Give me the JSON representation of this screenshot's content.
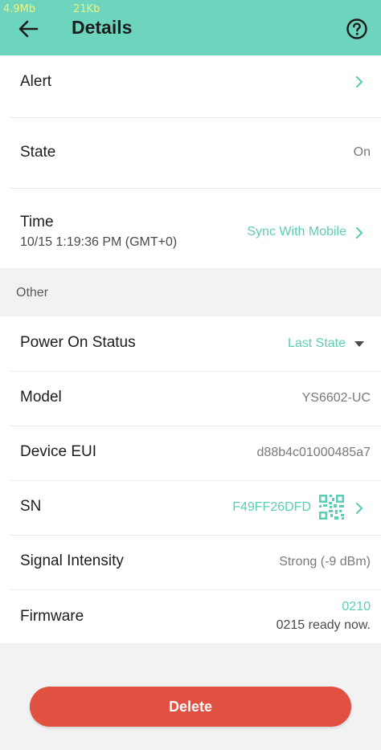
{
  "status_bar": {
    "memory": "4.9Mb",
    "network": "21Kb"
  },
  "header": {
    "title": "Details",
    "back_icon": "arrow-left-icon",
    "help_icon": "help-circle-icon"
  },
  "rows_top": [
    {
      "label": "Alert"
    },
    {
      "label": "State",
      "value": "On"
    },
    {
      "label": "Time",
      "sub": "10/15 1:19:36 PM (GMT+0)",
      "value": "Sync With Mobile"
    }
  ],
  "section": {
    "title": "Other"
  },
  "rows_other": [
    {
      "label": "Power On Status",
      "value": "Last State"
    },
    {
      "label": "Model",
      "value": "YS6602-UC"
    },
    {
      "label": "Device EUI",
      "value": "d88b4c01000485a7"
    },
    {
      "label": "SN",
      "value": "F49FF26DFD"
    },
    {
      "label": "Signal Intensity",
      "value": "Strong (-9 dBm)"
    },
    {
      "label": "Firmware",
      "value": "0210",
      "sub_value": "0215 ready now."
    }
  ],
  "footer": {
    "delete_label": "Delete"
  },
  "colors": {
    "header": "#6dd5be",
    "accent": "#5ccdb6",
    "danger": "#e15142",
    "background": "#f2f2f2"
  }
}
